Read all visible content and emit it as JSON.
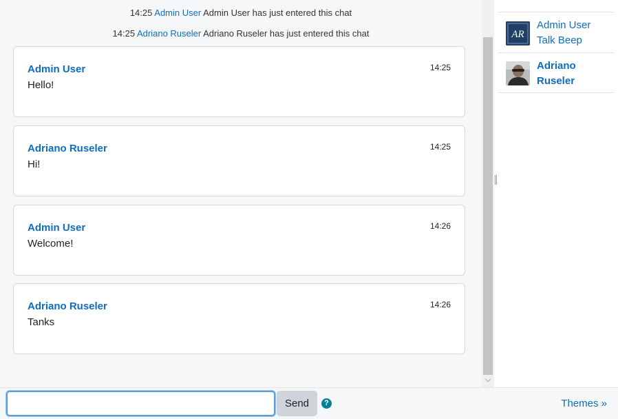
{
  "system_messages": [
    {
      "time": "14:25",
      "user": "Admin User",
      "text": "Admin User has just entered this chat"
    },
    {
      "time": "14:25",
      "user": "Adriano Ruseler",
      "text": "Adriano Ruseler has just entered this chat"
    }
  ],
  "messages": [
    {
      "author": "Admin User",
      "text": "Hello!",
      "time": "14:25"
    },
    {
      "author": "Adriano Ruseler",
      "text": "Hi!",
      "time": "14:25"
    },
    {
      "author": "Admin User",
      "text": "Welcome!",
      "time": "14:26"
    },
    {
      "author": "Adriano Ruseler",
      "text": "Tanks",
      "time": "14:26"
    }
  ],
  "users": [
    {
      "name_line1": "Admin User",
      "name_line2": "Talk Beep",
      "avatar_text": "AR"
    },
    {
      "name_line1": "Adriano",
      "name_line2": "Ruseler"
    }
  ],
  "composer": {
    "value": "",
    "placeholder": "",
    "send_label": "Send",
    "help_icon": "question-circle-icon"
  },
  "themes_link": "Themes »",
  "colors": {
    "link": "#0f6cbf",
    "help": "#008196",
    "input_focus": "#5d9cd7"
  }
}
